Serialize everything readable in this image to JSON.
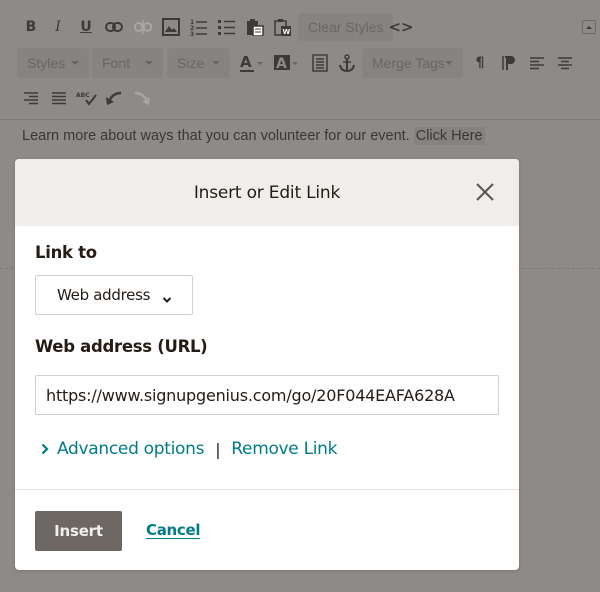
{
  "editor": {
    "toolbar": {
      "clear_styles_label": "Clear Styles",
      "styles_label": "Styles",
      "font_label": "Font",
      "size_label": "Size",
      "merge_tags_label": "Merge Tags",
      "bold_glyph": "B",
      "italic_glyph": "I",
      "underline_glyph": "U",
      "spellcheck_glyph": "ABC",
      "code_glyph": "<>"
    },
    "body_text": "Learn more about ways that you can volunteer for our event.",
    "link_text": "Click Here"
  },
  "modal": {
    "title": "Insert or Edit Link",
    "link_to_label": "Link to",
    "link_to_value": "Web address",
    "url_label": "Web address (URL)",
    "url_value": "https://www.signupgenius.com/go/20F044EAFA628A",
    "advanced_options_label": "Advanced options",
    "separator": "|",
    "remove_link_label": "Remove Link",
    "insert_label": "Insert",
    "cancel_label": "Cancel"
  },
  "colors": {
    "overlay_bg": "#8e8a87",
    "header_bg": "#efeeea",
    "accent_link": "#007c89",
    "primary_button": "#6e6864"
  }
}
